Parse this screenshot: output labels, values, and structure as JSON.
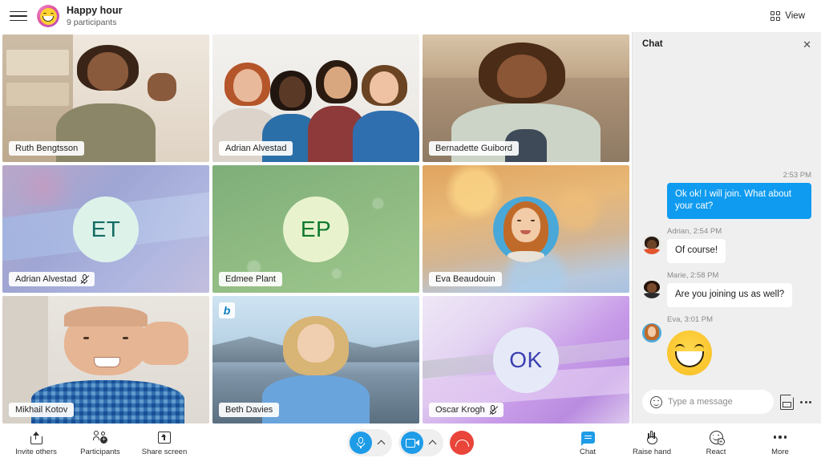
{
  "header": {
    "menu_icon": "hamburger-menu-icon",
    "avatar_icon": "smiley-meeting-avatar",
    "title": "Happy hour",
    "participants": "9 participants",
    "view_label": "View",
    "view_icon": "grid-view-icon"
  },
  "colors": {
    "accent_blue": "#1e9ce8",
    "message_blue": "#0f9bf0",
    "end_call_red": "#e9453a",
    "panel_gray": "#efefef"
  },
  "participants": [
    {
      "name": "Ruth Bengtsson",
      "muted": false,
      "kind": "video"
    },
    {
      "name": "Adrian Alvestad",
      "muted": false,
      "kind": "video"
    },
    {
      "name": "Bernadette Guibord",
      "muted": false,
      "kind": "video"
    },
    {
      "name": "Adrian Alvestad",
      "muted": true,
      "kind": "initials",
      "initials": "ET"
    },
    {
      "name": "Edmee Plant",
      "muted": false,
      "kind": "initials",
      "initials": "EP"
    },
    {
      "name": "Eva Beaudouin",
      "muted": false,
      "kind": "photo"
    },
    {
      "name": "Mikhail Kotov",
      "muted": false,
      "kind": "video"
    },
    {
      "name": "Beth Davies",
      "muted": false,
      "kind": "video",
      "badge": "bing-logo-badge"
    },
    {
      "name": "Oscar Krogh",
      "muted": true,
      "kind": "initials",
      "initials": "OK"
    }
  ],
  "chat": {
    "title": "Chat",
    "close_icon": "close-icon",
    "messages": [
      {
        "direction": "out",
        "meta": "2:53 PM",
        "text": "Ok ok! I will join. What about your cat?"
      },
      {
        "direction": "in",
        "meta": "Adrian, 2:54 PM",
        "text": "Of course!"
      },
      {
        "direction": "in",
        "meta": "Marie, 2:58 PM",
        "text": "Are you joining us as well?"
      },
      {
        "direction": "in",
        "meta": "Eva, 3:01 PM",
        "text": "",
        "emoji": "grinning-face-emoji"
      }
    ],
    "compose": {
      "placeholder": "Type a message",
      "emoji_icon": "emoji-picker-icon",
      "attach_icon": "attach-image-icon",
      "more_icon": "more-options-icon"
    }
  },
  "toolbar": {
    "left": [
      {
        "label": "Invite others",
        "icon": "share-invite-icon"
      },
      {
        "label": "Participants",
        "icon": "add-participants-icon"
      },
      {
        "label": "Share screen",
        "icon": "share-screen-icon"
      }
    ],
    "center": {
      "mic_icon": "microphone-icon",
      "mic_chevron_icon": "chevron-up-icon",
      "camera_icon": "camera-icon",
      "camera_chevron_icon": "chevron-up-icon",
      "end_call_icon": "end-call-icon"
    },
    "right": [
      {
        "label": "Chat",
        "icon": "chat-bubble-icon",
        "active": true
      },
      {
        "label": "Raise hand",
        "icon": "raise-hand-icon",
        "active": false
      },
      {
        "label": "React",
        "icon": "react-emoji-icon",
        "active": false
      },
      {
        "label": "More",
        "icon": "more-options-icon",
        "active": false
      }
    ]
  }
}
